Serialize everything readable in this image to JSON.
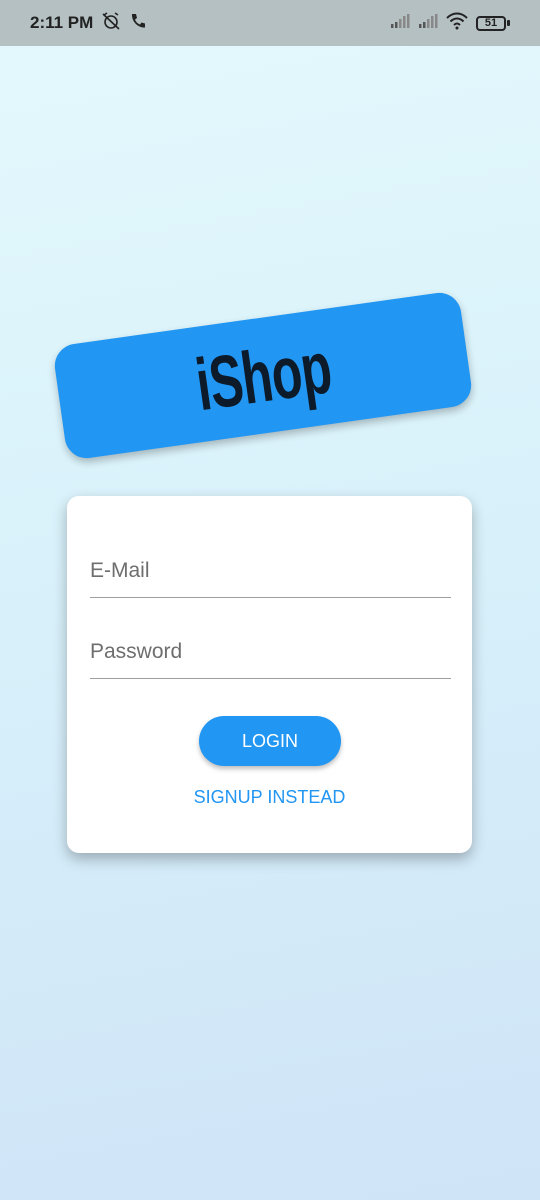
{
  "status_bar": {
    "time": "2:11 PM",
    "icons": [
      "alarm-off-icon",
      "phone-icon",
      "signal-icon",
      "signal-icon",
      "wifi-icon"
    ],
    "battery": "51"
  },
  "logo": {
    "text": "iShop",
    "badge_color": "#2196f3"
  },
  "form": {
    "email_placeholder": "E-Mail",
    "password_placeholder": "Password",
    "login_label": "LOGIN",
    "signup_label": "SIGNUP INSTEAD"
  },
  "colors": {
    "accent": "#2196f3",
    "logo_text": "#0c1a2a"
  }
}
